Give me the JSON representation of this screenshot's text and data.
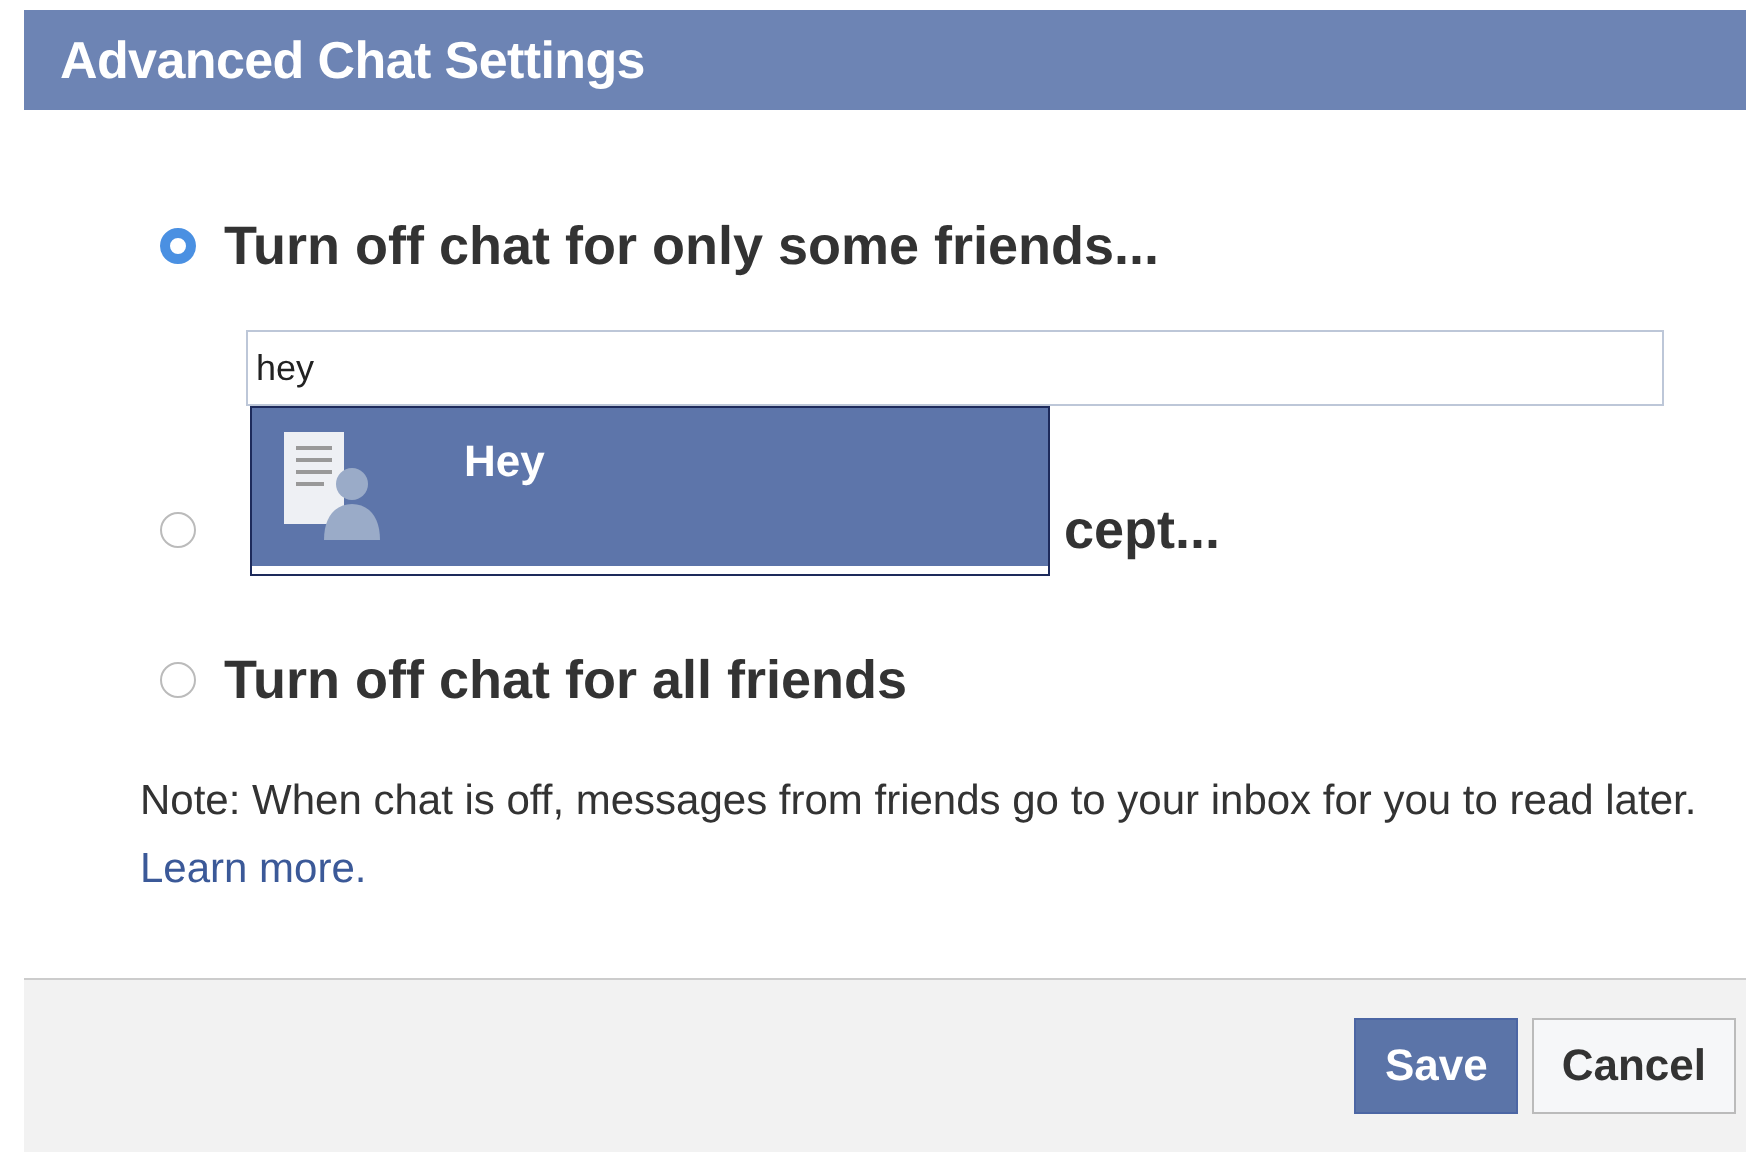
{
  "dialog": {
    "title": "Advanced Chat Settings"
  },
  "options": [
    {
      "label": "Turn off chat for only some friends...",
      "selected": true,
      "kind": "search"
    },
    {
      "label": "cept...",
      "selected": false,
      "kind": "covered"
    },
    {
      "label": "Turn off chat for all friends",
      "selected": false,
      "kind": "plain"
    }
  ],
  "search": {
    "value": "hey"
  },
  "suggestions": [
    {
      "name": "Hey",
      "selected": true
    }
  ],
  "note": {
    "text": "Note: When chat is off, messages from friends go to your inbox for you to read later.",
    "link": "Learn more."
  },
  "buttons": [
    {
      "label": "Save",
      "kind": "primary"
    },
    {
      "label": "Cancel",
      "kind": "secondary"
    }
  ]
}
